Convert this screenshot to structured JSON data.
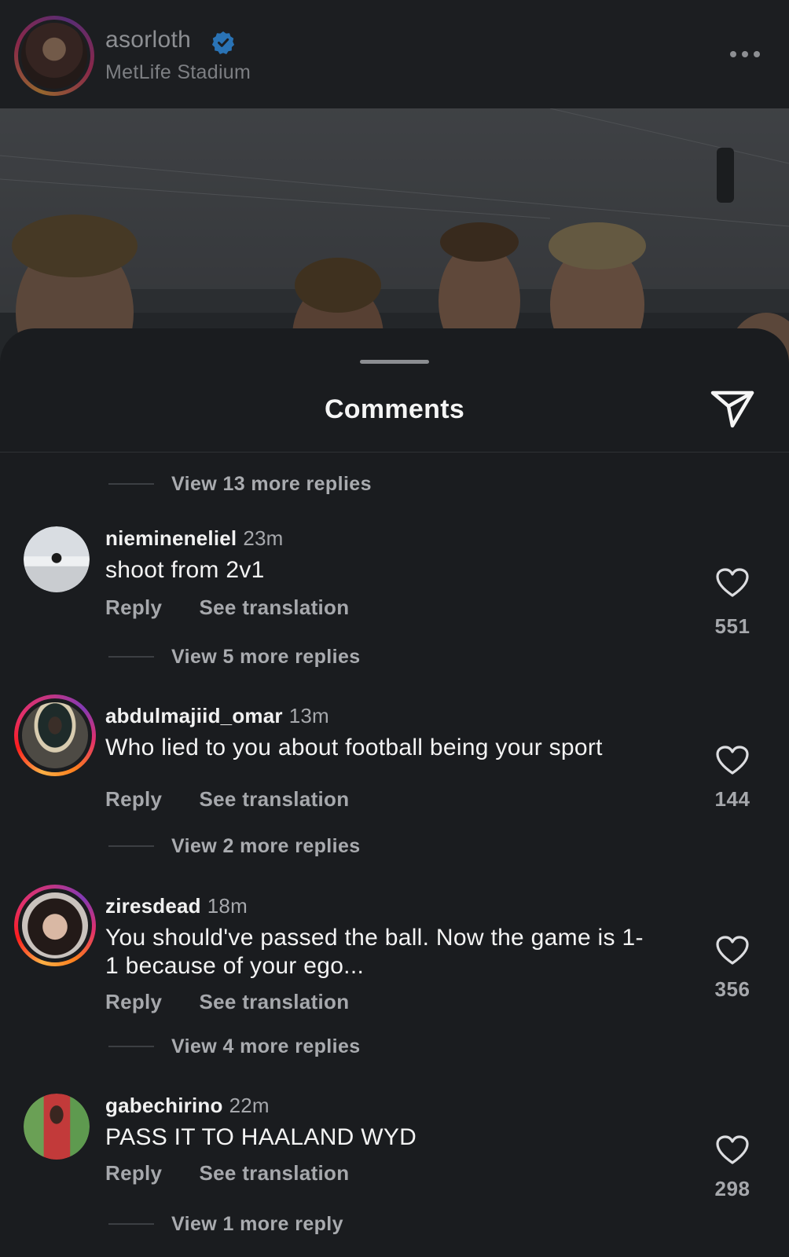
{
  "post": {
    "username": "asorloth",
    "location": "MetLife Stadium"
  },
  "sheet": {
    "title": "Comments"
  },
  "threads": {
    "top": "View 13 more replies"
  },
  "actions": {
    "reply": "Reply",
    "translate": "See translation"
  },
  "comments": [
    {
      "username": "niemineneliel",
      "time": "23m",
      "text": "shoot from 2v1",
      "likes": "551",
      "more_replies": "View 5 more replies",
      "has_story": false
    },
    {
      "username": "abdulmajiid_omar",
      "time": "13m",
      "text": "Who lied to you about football being your sport",
      "likes": "144",
      "more_replies": "View 2 more replies",
      "has_story": true
    },
    {
      "username": "ziresdead",
      "time": "18m",
      "text": "You should've passed the ball. Now the game is 1-1 because of your ego...",
      "likes": "356",
      "more_replies": "View 4 more replies",
      "has_story": true
    },
    {
      "username": "gabechirino",
      "time": "22m",
      "text": "PASS IT TO HAALAND WYD",
      "likes": "298",
      "more_replies": "View 1 more reply",
      "has_story": false
    }
  ],
  "colors": {
    "background": "#1a1c1f",
    "verified": "#3897f0",
    "muted_text": "#a6a8ac",
    "story_ring_start": "#fcb045",
    "story_ring_end": "#c13584"
  },
  "icons": {
    "verified": "verified-badge-icon",
    "more": "more-options-icon",
    "share": "paper-plane-icon",
    "like": "heart-outline-icon"
  }
}
